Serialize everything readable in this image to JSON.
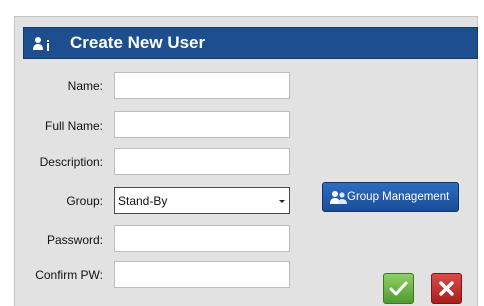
{
  "dialog": {
    "title": "Create New User",
    "title_icon": "user-info-icon"
  },
  "form": {
    "name": {
      "label": "Name:",
      "value": ""
    },
    "full_name": {
      "label": "Full Name:",
      "value": ""
    },
    "description": {
      "label": "Description:",
      "value": ""
    },
    "group": {
      "label": "Group:",
      "value": "Stand-By",
      "icon": "dropdown-caret-icon"
    },
    "password": {
      "label": "Password:",
      "value": ""
    },
    "confirm_pw": {
      "label": "Confirm PW:",
      "value": ""
    }
  },
  "buttons": {
    "group_management": {
      "label": "Group Management",
      "icon": "group-icon"
    },
    "ok": {
      "icon": "checkmark-icon"
    },
    "cancel": {
      "icon": "close-x-icon"
    }
  },
  "colors": {
    "titlebar": "#1d4f8e",
    "dialog_bg": "#e2e2e2",
    "button_blue": "#1a4d96",
    "ok_green": "#4e9a2e",
    "cancel_red": "#a81f1f"
  }
}
